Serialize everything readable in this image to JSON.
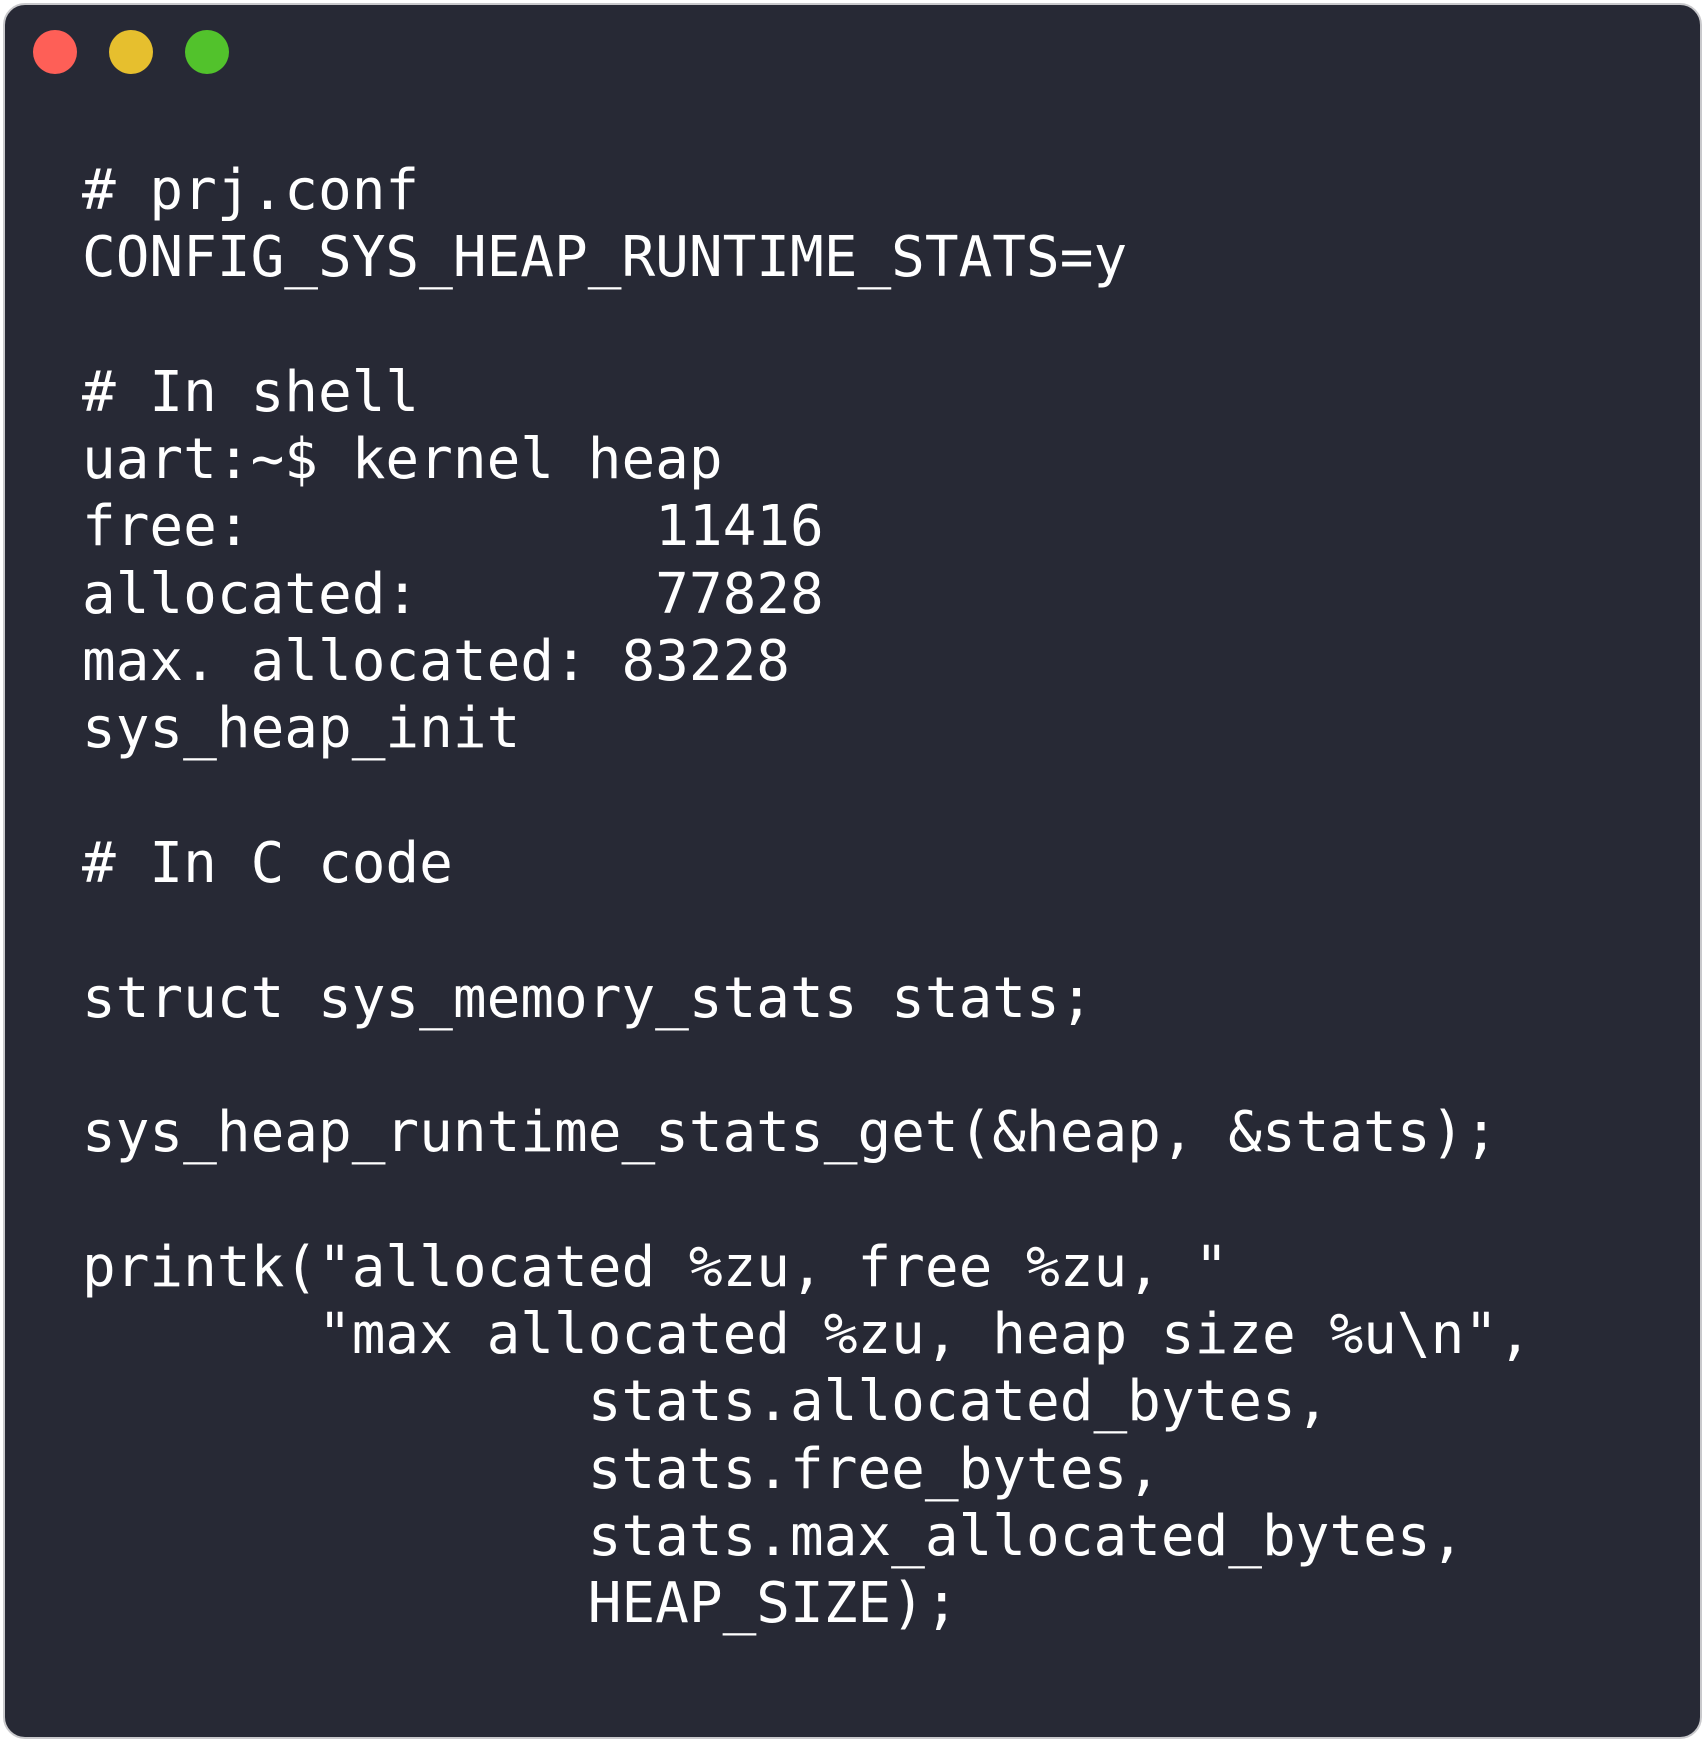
{
  "colors": {
    "background": "#272935",
    "text": "#ffffff",
    "close": "#fe5f57",
    "minimize": "#e6bf2e",
    "maximize": "#52c22c"
  },
  "window_controls": {
    "close_icon": "close-dot-icon",
    "minimize_icon": "minimize-dot-icon",
    "maximize_icon": "maximize-dot-icon"
  },
  "code_lines": [
    "# prj.conf",
    "CONFIG_SYS_HEAP_RUNTIME_STATS=y",
    "",
    "# In shell",
    "uart:~$ kernel heap",
    "free:            11416",
    "allocated:       77828",
    "max. allocated: 83228",
    "sys_heap_init",
    "",
    "# In C code",
    "",
    "struct sys_memory_stats stats;",
    "",
    "sys_heap_runtime_stats_get(&heap, &stats);",
    "",
    "printk(\"allocated %zu, free %zu, \"",
    "       \"max allocated %zu, heap size %u\\n\",",
    "               stats.allocated_bytes,",
    "               stats.free_bytes,",
    "               stats.max_allocated_bytes,",
    "               HEAP_SIZE);"
  ]
}
